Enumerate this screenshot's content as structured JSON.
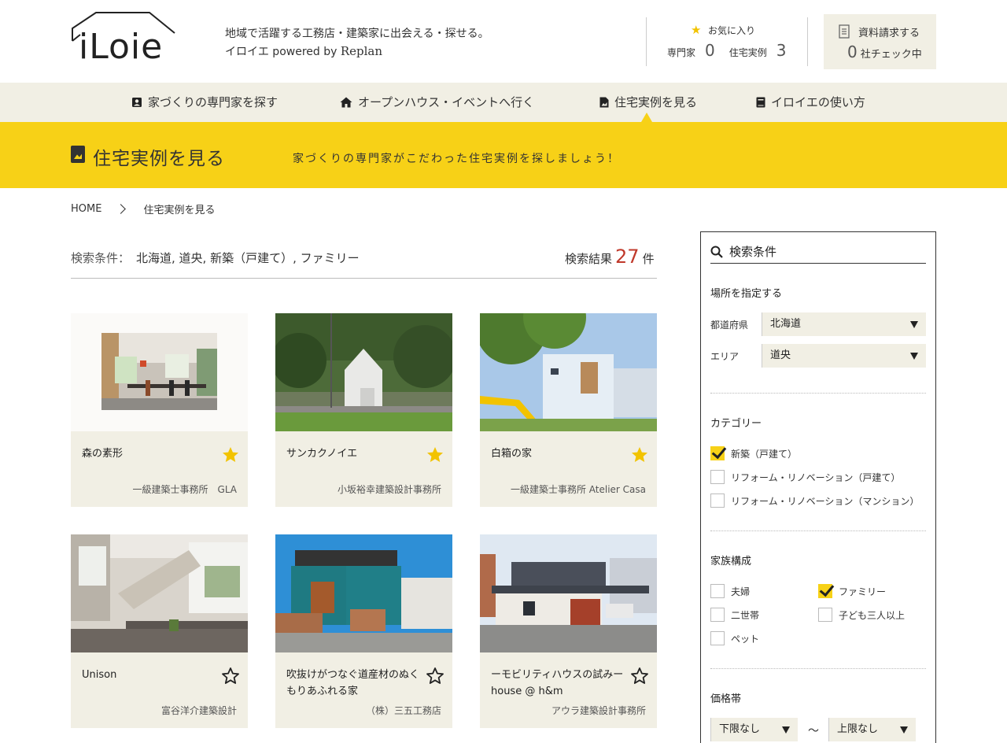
{
  "header": {
    "logo_text": "iLoie",
    "tagline_line1": "地域で活躍する工務店・建築家に出会える・探せる。",
    "tagline_line2_prefix": "イロイエ powered by ",
    "tagline_brand": "Replan",
    "favorites": {
      "title": "お気に入り",
      "experts_label": "専門家",
      "experts_count": "0",
      "cases_label": "住宅実例",
      "cases_count": "3"
    },
    "request": {
      "label": "資料請求する",
      "count": "0",
      "suffix": "社チェック中"
    }
  },
  "nav": {
    "items": [
      {
        "label": "家づくりの専門家を探す",
        "icon": "person-card-icon"
      },
      {
        "label": "オープンハウス・イベントへ行く",
        "icon": "house-icon"
      },
      {
        "label": "住宅実例を見る",
        "icon": "photo-document-icon"
      },
      {
        "label": "イロイエの使い方",
        "icon": "book-icon"
      }
    ]
  },
  "banner": {
    "title": "住宅実例を見る",
    "subtitle": "家づくりの専門家がこだわった住宅実例を探しましょう！"
  },
  "breadcrumb": {
    "home": "HOME",
    "current": "住宅実例を見る"
  },
  "results": {
    "conditions_label": "検索条件：",
    "conditions": "北海道, 道央, 新築（戸建て）, ファミリー",
    "count_label": "検索結果",
    "count": "27",
    "count_suffix": "件"
  },
  "cards": [
    {
      "title": "森の素形",
      "office": "一級建築士事務所　GLA",
      "favorited": true
    },
    {
      "title": "サンカクノイエ",
      "office": "小坂裕幸建築設計事務所",
      "favorited": true
    },
    {
      "title": "白箱の家",
      "office": "一級建築士事務所 Atelier Casa",
      "favorited": true
    },
    {
      "title": "Unison",
      "office": "富谷洋介建築設計",
      "favorited": false
    },
    {
      "title": "吹抜けがつなぐ道産材のぬくもりあふれる家",
      "office": "（株）三五工務店",
      "favorited": false
    },
    {
      "title": "ーモビリティハウスの試みーhouse @ h&m",
      "office": "アウラ建築設計事務所",
      "favorited": false
    }
  ],
  "sidebar": {
    "title": "検索条件",
    "location": {
      "title": "場所を指定する",
      "pref_label": "都道府県",
      "pref_value": "北海道",
      "area_label": "エリア",
      "area_value": "道央"
    },
    "category": {
      "title": "カテゴリー",
      "options": [
        {
          "label": "新築（戸建て）",
          "checked": true
        },
        {
          "label": "リフォーム・リノベーション（戸建て）",
          "checked": false
        },
        {
          "label": "リフォーム・リノベーション（マンション）",
          "checked": false
        }
      ]
    },
    "family": {
      "title": "家族構成",
      "options": [
        {
          "label": "夫婦",
          "checked": false
        },
        {
          "label": "ファミリー",
          "checked": true
        },
        {
          "label": "二世帯",
          "checked": false
        },
        {
          "label": "子ども三人以上",
          "checked": false
        },
        {
          "label": "ペット",
          "checked": false
        }
      ]
    },
    "price": {
      "title": "価格帯",
      "min_value": "下限なし",
      "separator": "〜",
      "max_value": "上限なし"
    }
  },
  "colors": {
    "accent_yellow": "#f7d117",
    "beige": "#f1efe4",
    "count_red": "#c0392b"
  }
}
